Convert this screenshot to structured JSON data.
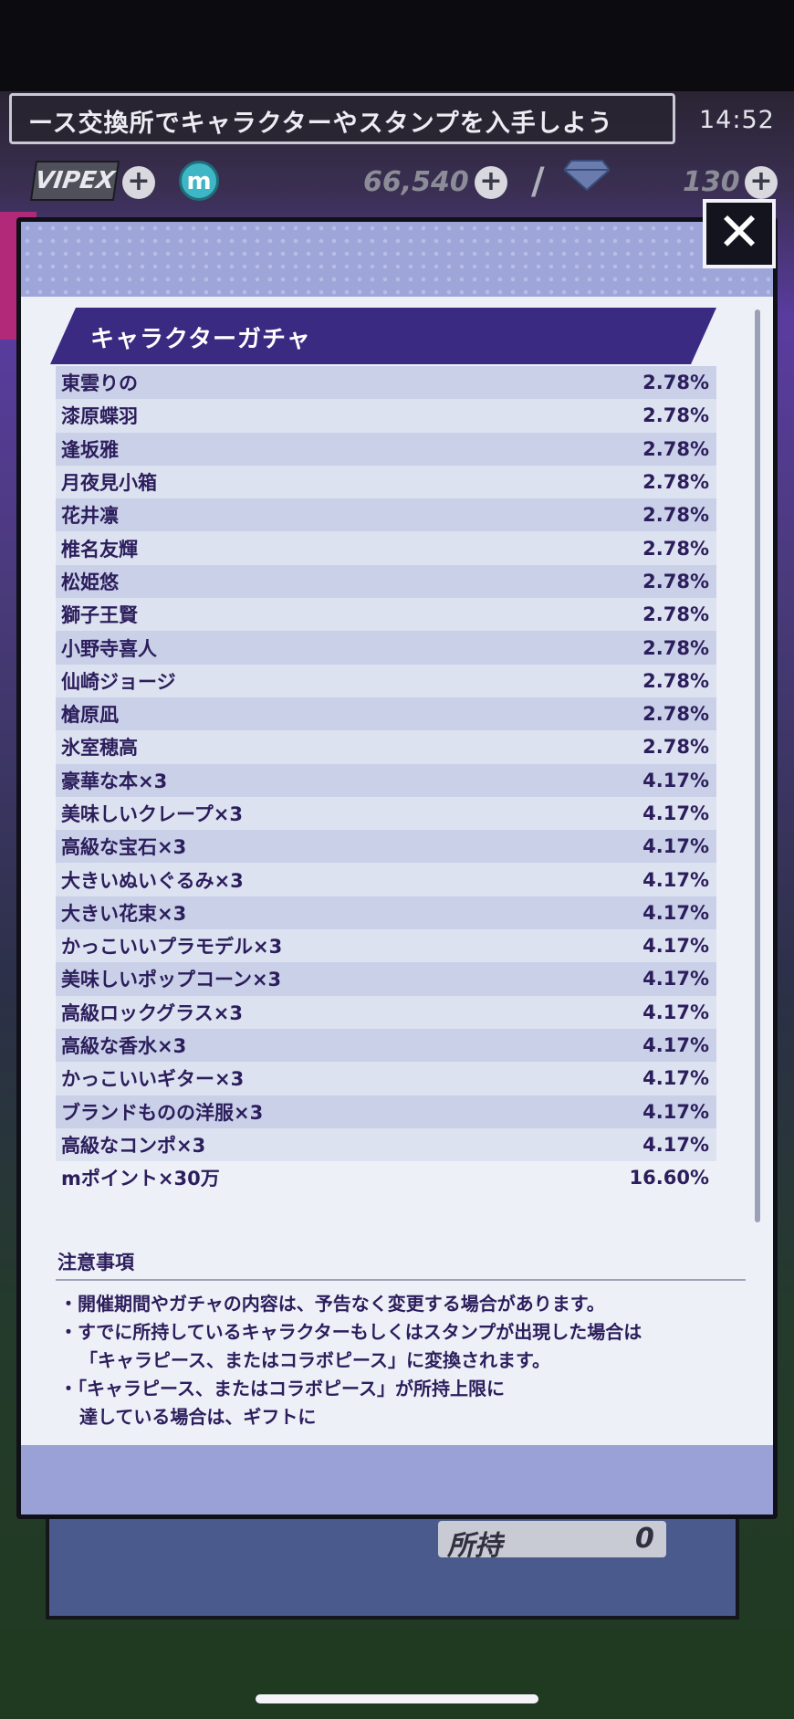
{
  "ticker_text": "ース交換所でキャラクターやスタンプを入手しよう",
  "clock": "14:52",
  "hud": {
    "vip_label": "VIPEX",
    "m_label": "m",
    "coins": "66,540",
    "slash": "/",
    "gems": "130",
    "plus": "+"
  },
  "close_label": "✕",
  "section_title": "キャラクターガチャ",
  "items": [
    {
      "name": "東雲りの",
      "rate": "2.78%"
    },
    {
      "name": "漆原蝶羽",
      "rate": "2.78%"
    },
    {
      "name": "逢坂雅",
      "rate": "2.78%"
    },
    {
      "name": "月夜見小箱",
      "rate": "2.78%"
    },
    {
      "name": "花井凛",
      "rate": "2.78%"
    },
    {
      "name": "椎名友輝",
      "rate": "2.78%"
    },
    {
      "name": "松姫悠",
      "rate": "2.78%"
    },
    {
      "name": "獅子王賢",
      "rate": "2.78%"
    },
    {
      "name": "小野寺喜人",
      "rate": "2.78%"
    },
    {
      "name": "仙崎ジョージ",
      "rate": "2.78%"
    },
    {
      "name": "槍原凪",
      "rate": "2.78%"
    },
    {
      "name": "氷室穂高",
      "rate": "2.78%"
    },
    {
      "name": "豪華な本×3",
      "rate": "4.17%"
    },
    {
      "name": "美味しいクレープ×3",
      "rate": "4.17%"
    },
    {
      "name": "高級な宝石×3",
      "rate": "4.17%"
    },
    {
      "name": "大きいぬいぐるみ×3",
      "rate": "4.17%"
    },
    {
      "name": "大きい花束×3",
      "rate": "4.17%"
    },
    {
      "name": "かっこいいプラモデル×3",
      "rate": "4.17%"
    },
    {
      "name": "美味しいポップコーン×3",
      "rate": "4.17%"
    },
    {
      "name": "高級ロックグラス×3",
      "rate": "4.17%"
    },
    {
      "name": "高級な香水×3",
      "rate": "4.17%"
    },
    {
      "name": "かっこいいギター×3",
      "rate": "4.17%"
    },
    {
      "name": "ブランドものの洋服×3",
      "rate": "4.17%"
    },
    {
      "name": "高級なコンポ×3",
      "rate": "4.17%"
    },
    {
      "name": "mポイント×30万",
      "rate": "16.60%"
    }
  ],
  "notes_title": "注意事項",
  "notes": [
    "・開催期間やガチャの内容は、予告なく変更する場合があります。",
    "・すでに所持しているキャラクターもしくはスタンプが出現した場合は",
    "「キャラピース、またはコラボピース」に変換されます。",
    "・「キャラピース、またはコラボピース」が所持上限に",
    "達している場合は、ギフトに"
  ],
  "owned": {
    "label": "所持",
    "count": "0"
  }
}
